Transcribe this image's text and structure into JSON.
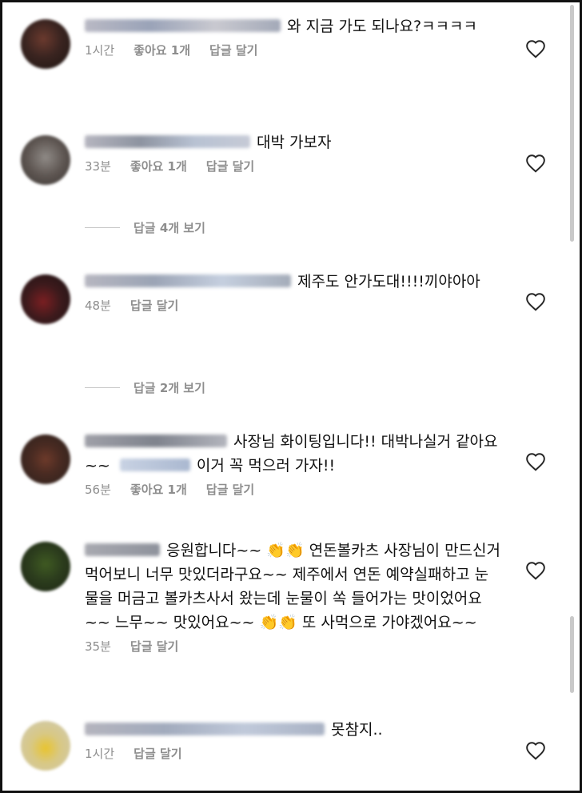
{
  "comments": [
    {
      "text": "와 지금 가도 되나요?ㅋㅋㅋㅋ",
      "time": "1시간",
      "likes": "좋아요 1개",
      "reply": "답글 달기"
    },
    {
      "text": "대박 가보자",
      "time": "33분",
      "likes": "좋아요 1개",
      "reply": "답글 달기"
    },
    {
      "text": "제주도 안가도대!!!!끼야아아",
      "time": "48분",
      "likes": "",
      "reply": "답글 달기"
    },
    {
      "text_a": "사장님 화이팅입니다!! 대박나실거 같아요~~",
      "text_b": "이거 꼭 먹으러 가자!!",
      "time": "56분",
      "likes": "좋아요 1개",
      "reply": "답글 달기"
    },
    {
      "text_a": "응원합니다~~",
      "clap": "👏👏",
      "text_b": "연돈볼카츠 사장님이 만드신거 먹어보니 너무 맛있더라구요~~ 제주에서 연돈 예약실패하고 눈물을 머금고 볼카츠사서 왔는데 눈물이 쏙 들어가는 맛이었어요~~ 느무~~ 맛있어요~~",
      "text_c": "또 사먹으로 가야겠어요~~",
      "time": "35분",
      "likes": "",
      "reply": "답글 달기"
    },
    {
      "text": "못참지..",
      "time": "1시간",
      "likes": "",
      "reply": "답글 달기"
    }
  ],
  "view_replies": [
    {
      "label": "답글 4개 보기"
    },
    {
      "label": "답글 2개 보기"
    }
  ],
  "icons": {
    "like": "heart-outline-icon"
  },
  "colors": {
    "meta": "#8e8e8e",
    "text": "#111111"
  }
}
